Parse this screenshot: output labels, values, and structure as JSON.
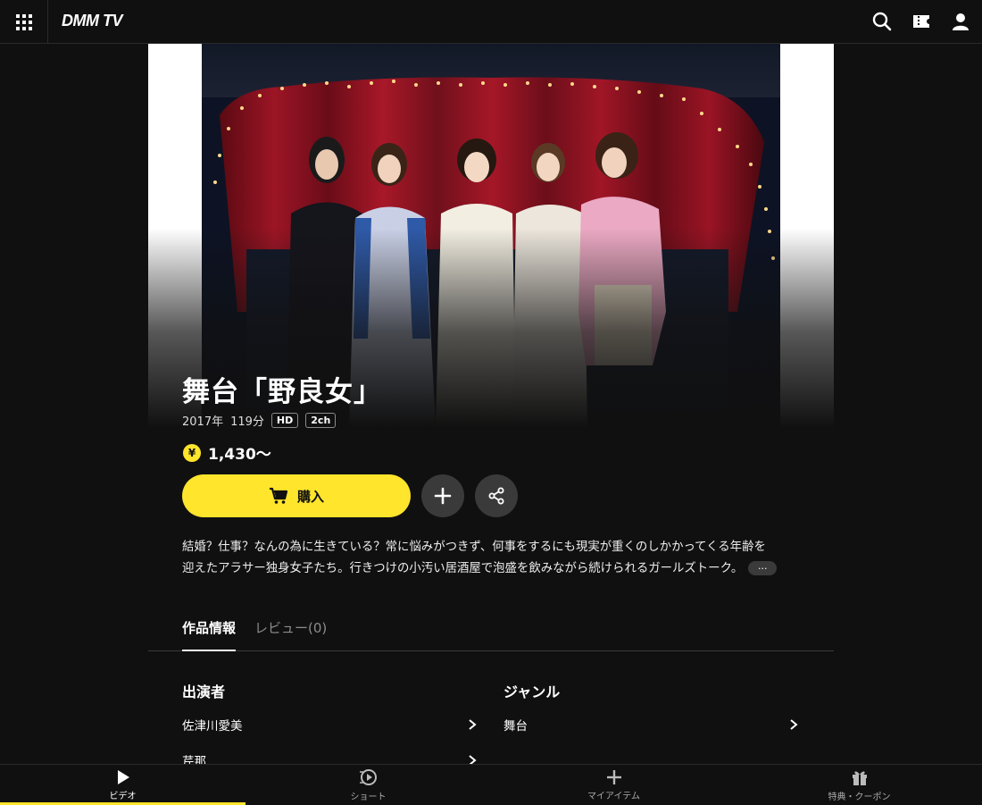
{
  "header": {
    "logo": "DMM TV",
    "icons": [
      "grid-menu-icon",
      "search-icon",
      "ticket-icon",
      "user-icon"
    ]
  },
  "content": {
    "title": "舞台「野良女」",
    "year": "2017年",
    "duration": "119分",
    "badges": [
      "HD",
      "2ch"
    ],
    "price_symbol": "¥",
    "price": "1,430〜",
    "buy_label": "購入",
    "synopsis_line1": "結婚？仕事？なんの為に生きている？常に悩みがつきず、何事をするにも現実が重くのしかかってくる年齢を",
    "synopsis_line2": "迎えたアラサー独身女子たち。行きつけの小汚い居酒屋で泡盛を飲みながら続けられるガールズトーク。",
    "more_label": "···"
  },
  "tabs": [
    {
      "label": "作品情報",
      "active": true
    },
    {
      "label": "レビュー(0)",
      "active": false
    }
  ],
  "cast": {
    "title": "出演者",
    "items": [
      "佐津川愛美",
      "芹那"
    ]
  },
  "genre": {
    "title": "ジャンル",
    "items": [
      "舞台"
    ]
  },
  "bottom_nav": [
    {
      "label": "ビデオ",
      "icon": "play-icon",
      "active": true
    },
    {
      "label": "ショート",
      "icon": "short-play-icon",
      "active": false
    },
    {
      "label": "マイアイテム",
      "icon": "plus-icon",
      "active": false
    },
    {
      "label": "特典・クーポン",
      "icon": "gift-icon",
      "active": false
    }
  ],
  "colors": {
    "accent": "#ffe52b",
    "background": "#101010",
    "button_gray": "#3a3a3a"
  }
}
